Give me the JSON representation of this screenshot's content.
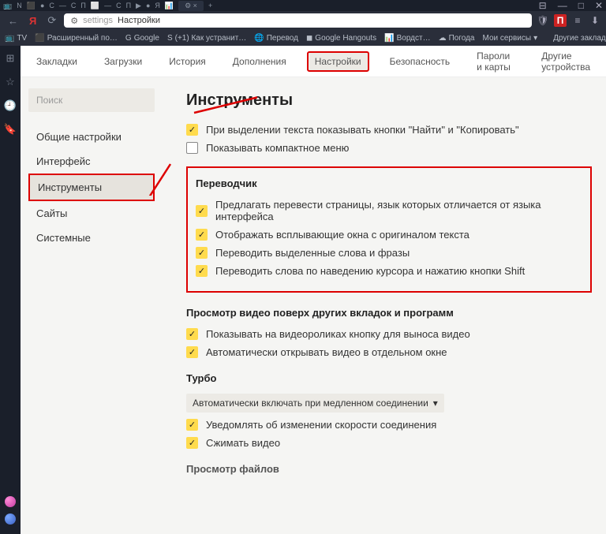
{
  "addressbar": {
    "prefix": "settings",
    "text": "Настройки"
  },
  "bookmarks": {
    "items": [
      "TV",
      "Расширенный по…",
      "Google",
      "(+1) Как устранит…",
      "Перевод",
      "Google Hangouts",
      "Вордст…",
      "Погода",
      "Мои сервисы"
    ],
    "other": "Другие закладки"
  },
  "settingsNav": {
    "items": [
      "Закладки",
      "Загрузки",
      "История",
      "Дополнения",
      "Настройки",
      "Безопасность",
      "Пароли и карты",
      "Другие устройства"
    ],
    "activeIndex": 4
  },
  "leftNav": {
    "search": "Поиск",
    "items": [
      "Общие настройки",
      "Интерфейс",
      "Инструменты",
      "Сайты",
      "Системные"
    ],
    "activeIndex": 2
  },
  "content": {
    "title": "Инструменты",
    "topChecks": [
      {
        "checked": true,
        "label": "При выделении текста показывать кнопки \"Найти\" и \"Копировать\""
      },
      {
        "checked": false,
        "label": "Показывать компактное меню"
      }
    ],
    "translator": {
      "title": "Переводчик",
      "items": [
        {
          "checked": true,
          "label": "Предлагать перевести страницы, язык которых отличается от языка интерфейса"
        },
        {
          "checked": true,
          "label": "Отображать всплывающие окна с оригиналом текста"
        },
        {
          "checked": true,
          "label": "Переводить выделенные слова и фразы"
        },
        {
          "checked": true,
          "label": "Переводить слова по наведению курсора и нажатию кнопки Shift"
        }
      ]
    },
    "video": {
      "title": "Просмотр видео поверх других вкладок и программ",
      "items": [
        {
          "checked": true,
          "label": "Показывать на видеороликах кнопку для выноса видео"
        },
        {
          "checked": true,
          "label": "Автоматически открывать видео в отдельном окне"
        }
      ]
    },
    "turbo": {
      "title": "Турбо",
      "select": "Автоматически включать при медленном соединении",
      "items": [
        {
          "checked": true,
          "label": "Уведомлять об изменении скорости соединения"
        },
        {
          "checked": true,
          "label": "Сжимать видео"
        }
      ]
    },
    "files": {
      "title": "Просмотр файлов"
    }
  }
}
